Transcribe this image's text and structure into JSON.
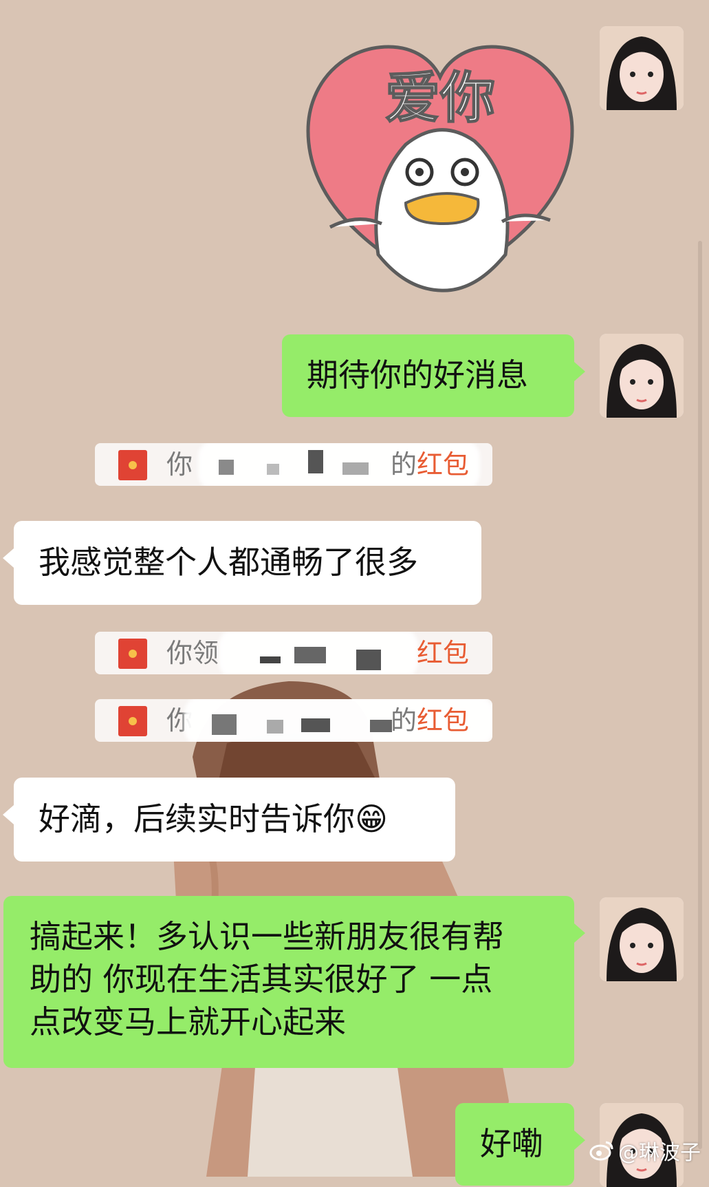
{
  "messages": [
    {
      "id": "sticker",
      "sender": "me",
      "type": "sticker",
      "sticker_text": "爱你"
    },
    {
      "id": "m1",
      "sender": "me",
      "type": "text",
      "text": "期待你的好消息"
    },
    {
      "id": "rp1",
      "type": "system",
      "prefix": "你",
      "middle": "的",
      "highlight": "红包"
    },
    {
      "id": "m2",
      "sender": "other",
      "type": "text",
      "text": "我感觉整个人都通畅了很多"
    },
    {
      "id": "rp2",
      "type": "system",
      "prefix": "你领",
      "middle": "",
      "highlight": "红包"
    },
    {
      "id": "rp3",
      "type": "system",
      "prefix": "你",
      "middle": "的",
      "highlight": "红包"
    },
    {
      "id": "m3",
      "sender": "other",
      "type": "text",
      "text": "好滴，后续实时告诉你😁"
    },
    {
      "id": "m4",
      "sender": "me",
      "type": "text",
      "lines": [
        "搞起来！多认识一些新朋友很有帮",
        "助的 你现在生活其实很好了 一点",
        "点改变马上就开心起来"
      ]
    },
    {
      "id": "m5",
      "sender": "me",
      "type": "text",
      "text": "好嘞"
    }
  ],
  "watermark": {
    "text": "@琳波子"
  },
  "colors": {
    "background": "#d9c4b4",
    "green_bubble": "#95ec69",
    "white_bubble": "#ffffff",
    "red_packet_accent": "#e85c33"
  }
}
